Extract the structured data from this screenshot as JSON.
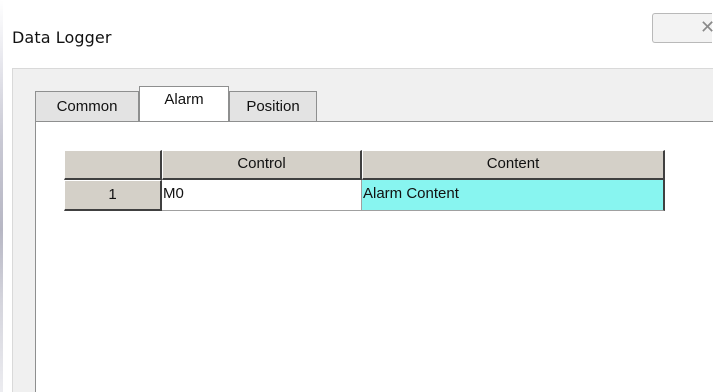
{
  "window": {
    "title": "Data Logger",
    "close_icon": "close-icon"
  },
  "tabs": [
    {
      "label": "Common",
      "active": false
    },
    {
      "label": "Alarm",
      "active": true
    },
    {
      "label": "Position",
      "active": false
    }
  ],
  "table": {
    "columns": [
      "",
      "Control",
      "Content"
    ],
    "rows": [
      {
        "index": "1",
        "control": "M0",
        "content": "Alarm Content"
      }
    ]
  },
  "colors": {
    "content_cell_bg": "#88f5f0",
    "header_bg": "#d4d0c8",
    "dialog_bg": "#f0f0f0"
  }
}
